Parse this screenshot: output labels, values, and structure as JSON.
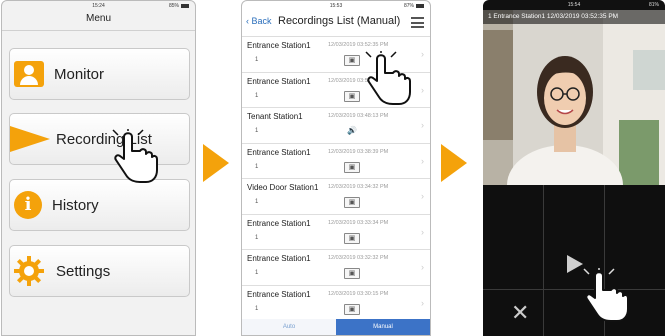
{
  "screen1": {
    "time": "15:24",
    "battery": "85%",
    "title": "Menu",
    "items": [
      {
        "label": "Monitor",
        "icon": "monitor-person-icon"
      },
      {
        "label": "Recording List",
        "icon": "play-arrow-icon"
      },
      {
        "label": "History",
        "icon": "info-icon"
      },
      {
        "label": "Settings",
        "icon": "gear-icon"
      }
    ]
  },
  "screen2": {
    "time": "15:53",
    "battery": "87%",
    "back_label": "Back",
    "title": "Recordings List (Manual)",
    "rows": [
      {
        "name": "Entrance Station1",
        "num": "1",
        "timestamp": "12/03/2019 03:52:35 PM",
        "media": "video"
      },
      {
        "name": "Entrance Station1",
        "num": "1",
        "timestamp": "12/03/2019 03:51:09 PM",
        "media": "video"
      },
      {
        "name": "Tenant Station1",
        "num": "1",
        "timestamp": "12/03/2019 03:48:13 PM",
        "media": "audio"
      },
      {
        "name": "Entrance Station1",
        "num": "1",
        "timestamp": "12/03/2019 03:38:39 PM",
        "media": "video"
      },
      {
        "name": "Video Door Station1",
        "num": "1",
        "timestamp": "12/03/2019 03:34:32 PM",
        "media": "video"
      },
      {
        "name": "Entrance Station1",
        "num": "1",
        "timestamp": "12/03/2019 03:33:34 PM",
        "media": "video"
      },
      {
        "name": "Entrance Station1",
        "num": "1",
        "timestamp": "12/03/2019 03:32:32 PM",
        "media": "video"
      },
      {
        "name": "Entrance Station1",
        "num": "1",
        "timestamp": "12/03/2019 03:30:15 PM",
        "media": "video"
      }
    ],
    "tabs": {
      "auto": "Auto",
      "manual": "Manual"
    }
  },
  "screen3": {
    "time": "15:54",
    "battery": "81%",
    "banner": "1 Entrance Station1 12/03/2019 03:52:35 PM"
  },
  "colors": {
    "accent": "#f4a20b",
    "tab_active": "#3c73c7",
    "link": "#2a6ebb"
  }
}
